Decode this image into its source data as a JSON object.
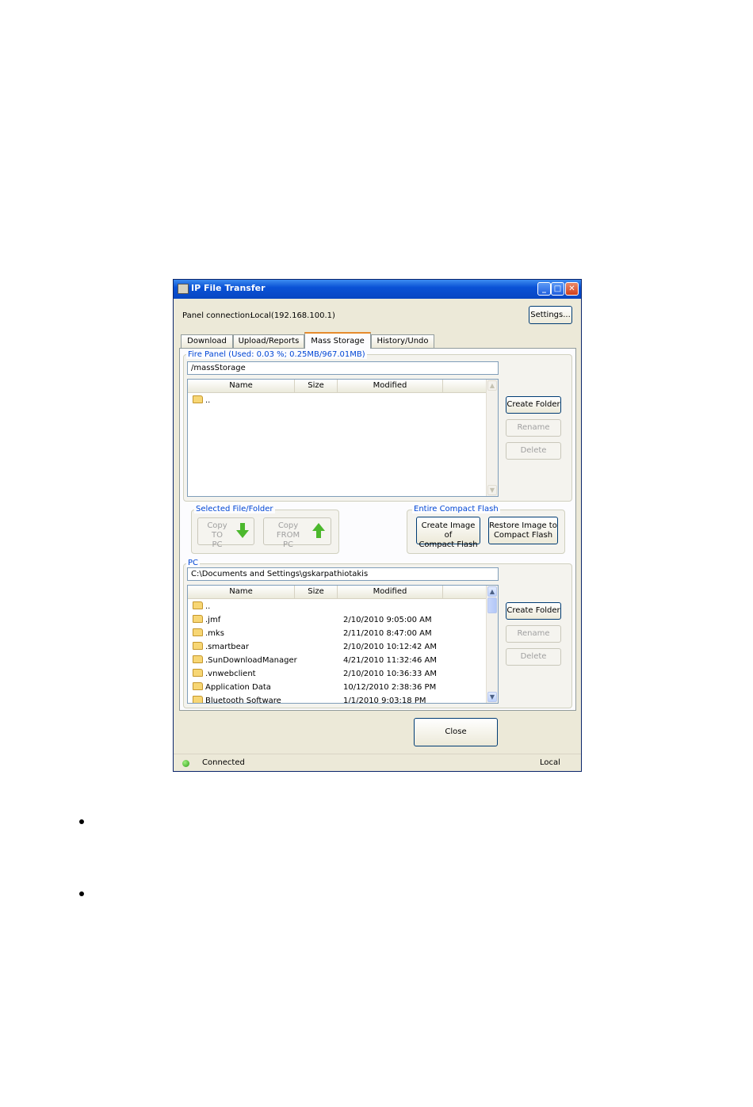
{
  "window": {
    "title": "IP File Transfer",
    "controls": {
      "minimize": "_",
      "maximize": "□",
      "close": "✕"
    }
  },
  "connection": {
    "label": "Panel connection:",
    "value": "Local(192.168.100.1)",
    "settings_button": "Settings..."
  },
  "tabs": [
    {
      "label": "Download",
      "active": false
    },
    {
      "label": "Upload/Reports",
      "active": false
    },
    {
      "label": "Mass Storage",
      "active": true
    },
    {
      "label": "History/Undo",
      "active": false
    }
  ],
  "fire_panel": {
    "group_title": "Fire Panel (Used: 0.03 %; 0.25MB/967.01MB)",
    "path": "/massStorage",
    "columns": [
      "Name",
      "Size",
      "Modified"
    ],
    "rows": [
      {
        "name": "..",
        "size": "",
        "modified": ""
      }
    ],
    "buttons": {
      "create_folder": "Create Folder",
      "rename": "Rename",
      "delete": "Delete"
    },
    "icons": {
      "folder": "folder-icon",
      "scroll_up": "▲",
      "scroll_down": "▼"
    }
  },
  "selected_file": {
    "group_title": "Selected File/Folder",
    "copy_to_pc": {
      "line1": "Copy TO",
      "line2": "PC",
      "icon": "arrow-down-icon"
    },
    "copy_from_pc": {
      "line1": "Copy FROM",
      "line2": "PC",
      "icon": "arrow-up-icon"
    }
  },
  "compact_flash": {
    "group_title": "Entire Compact Flash",
    "create_image": {
      "line1": "Create Image of",
      "line2": "Compact Flash"
    },
    "restore_image": {
      "line1": "Restore Image to",
      "line2": "Compact Flash"
    }
  },
  "pc": {
    "group_title": "PC",
    "path": "C:\\Documents and Settings\\gskarpathiotakis",
    "columns": [
      "Name",
      "Size",
      "Modified"
    ],
    "rows": [
      {
        "name": "..",
        "size": "",
        "modified": ""
      },
      {
        "name": ".jmf",
        "size": "",
        "modified": "2/10/2010 9:05:00 AM"
      },
      {
        "name": ".mks",
        "size": "",
        "modified": "2/11/2010 8:47:00 AM"
      },
      {
        "name": ".smartbear",
        "size": "",
        "modified": "2/10/2010 10:12:42 AM"
      },
      {
        "name": ".SunDownloadManager",
        "size": "",
        "modified": "4/21/2010 11:32:46 AM"
      },
      {
        "name": ".vnwebclient",
        "size": "",
        "modified": "2/10/2010 10:36:33 AM"
      },
      {
        "name": "Application Data",
        "size": "",
        "modified": "10/12/2010 2:38:36 PM"
      },
      {
        "name": "Bluetooth Software",
        "size": "",
        "modified": "1/1/2010 9:03:18 PM"
      }
    ],
    "buttons": {
      "create_folder": "Create Folder",
      "rename": "Rename",
      "delete": "Delete"
    }
  },
  "close_button": "Close",
  "status": {
    "left": "Connected",
    "right": "Local",
    "color_connected": "#2f9e19"
  },
  "accent_colors": {
    "titlebar": "#0a52d6",
    "group_title": "#0046d5",
    "active_tab": "#e68b2c"
  }
}
